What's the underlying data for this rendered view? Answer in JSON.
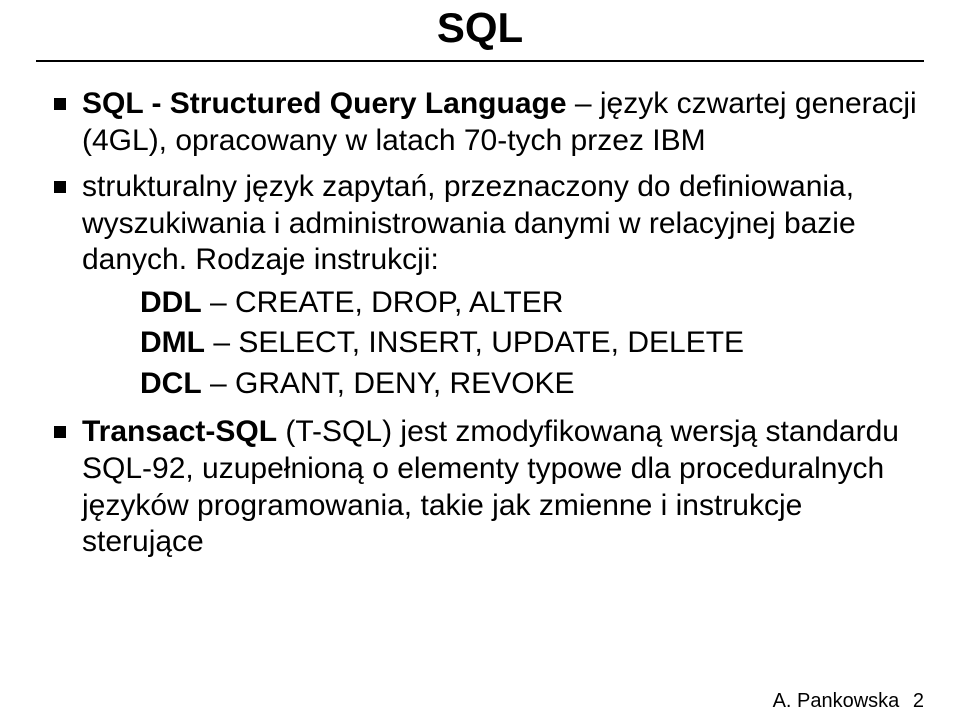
{
  "title": "SQL",
  "bullets": [
    {
      "term": "SQL - Structured Query Language",
      "rest": " – język czwartej generacji (4GL), opracowany w latach 70-tych przez IBM"
    },
    {
      "plain": "strukturalny język zapytań, przeznaczony do definiowania, wyszukiwania i administrowania danymi w relacyjnej bazie danych. Rodzaje instrukcji:"
    },
    {
      "term": "Transact-SQL",
      "rest": " (T-SQL) jest zmodyfikowaną wersją standardu SQL-92, uzupełnioną o elementy typowe dla proceduralnych języków programowania, takie jak zmienne i instrukcje sterujące"
    }
  ],
  "sub": [
    {
      "term": "DDL",
      "rest": " – CREATE, DROP, ALTER"
    },
    {
      "term": "DML",
      "rest": " – SELECT, INSERT, UPDATE, DELETE"
    },
    {
      "term": "DCL",
      "rest": " – GRANT, DENY, REVOKE"
    }
  ],
  "footer": {
    "author": "A. Pankowska",
    "page": "2"
  }
}
